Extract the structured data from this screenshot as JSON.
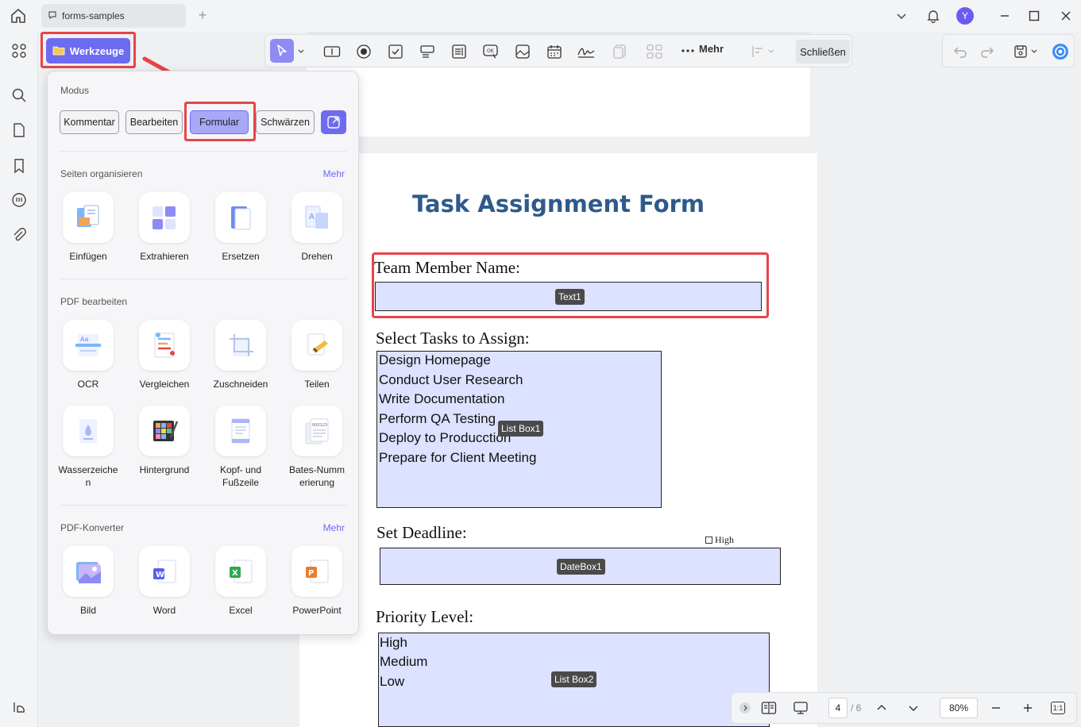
{
  "window": {
    "tab_title": "forms-samples",
    "avatar_initial": "Y"
  },
  "toolbar": {
    "werkzeuge_label": "Werkzeuge",
    "more_label": "Mehr",
    "close_label": "Schließen"
  },
  "panel": {
    "mode_section": "Modus",
    "modes": [
      "Kommentar",
      "Bearbeiten",
      "Formular",
      "Schwärzen"
    ],
    "active_mode": "Formular",
    "organize_section": "Seiten organisieren",
    "organize_more": "Mehr",
    "organize_tools": [
      "Einfügen",
      "Extrahieren",
      "Ersetzen",
      "Drehen"
    ],
    "edit_section": "PDF bearbeiten",
    "edit_tools_row1": [
      "OCR",
      "Vergleichen",
      "Zuschneiden",
      "Teilen"
    ],
    "edit_tools_row2": [
      "Wasserzeiche n",
      "Hintergrund",
      "Kopf- und Fußzeile",
      "Bates-Numm erierung"
    ],
    "converter_section": "PDF-Konverter",
    "converter_more": "Mehr",
    "converter_tools": [
      "Bild",
      "Word",
      "Excel",
      "PowerPoint"
    ]
  },
  "document": {
    "title": "Task Assignment Form",
    "team_label": "Team Member Name:",
    "text_field_tag": "Text1",
    "tasks_label": "Select Tasks to Assign:",
    "tasks": [
      "Design Homepage",
      "Conduct User Research",
      "Write Documentation",
      "Perform QA Testing",
      "Deploy to Producction",
      "Prepare for Client Meeting"
    ],
    "listbox1_tag": "List Box1",
    "deadline_label": "Set Deadline:",
    "checkbox_label": "High",
    "datebox_tag": "DateBox1",
    "priority_label": "Priority Level:",
    "priorities": [
      "High",
      "Medium",
      "Low"
    ],
    "listbox2_tag": "List Box2"
  },
  "navigation": {
    "current_page": "4",
    "total_pages": "/ 6",
    "zoom": "80%",
    "fit_label": "1:1"
  },
  "colors": {
    "accent": "#6d6bf0",
    "highlight": "#e8434a",
    "field_fill": "#dce2ff",
    "title_blue": "#2f5a8a"
  }
}
